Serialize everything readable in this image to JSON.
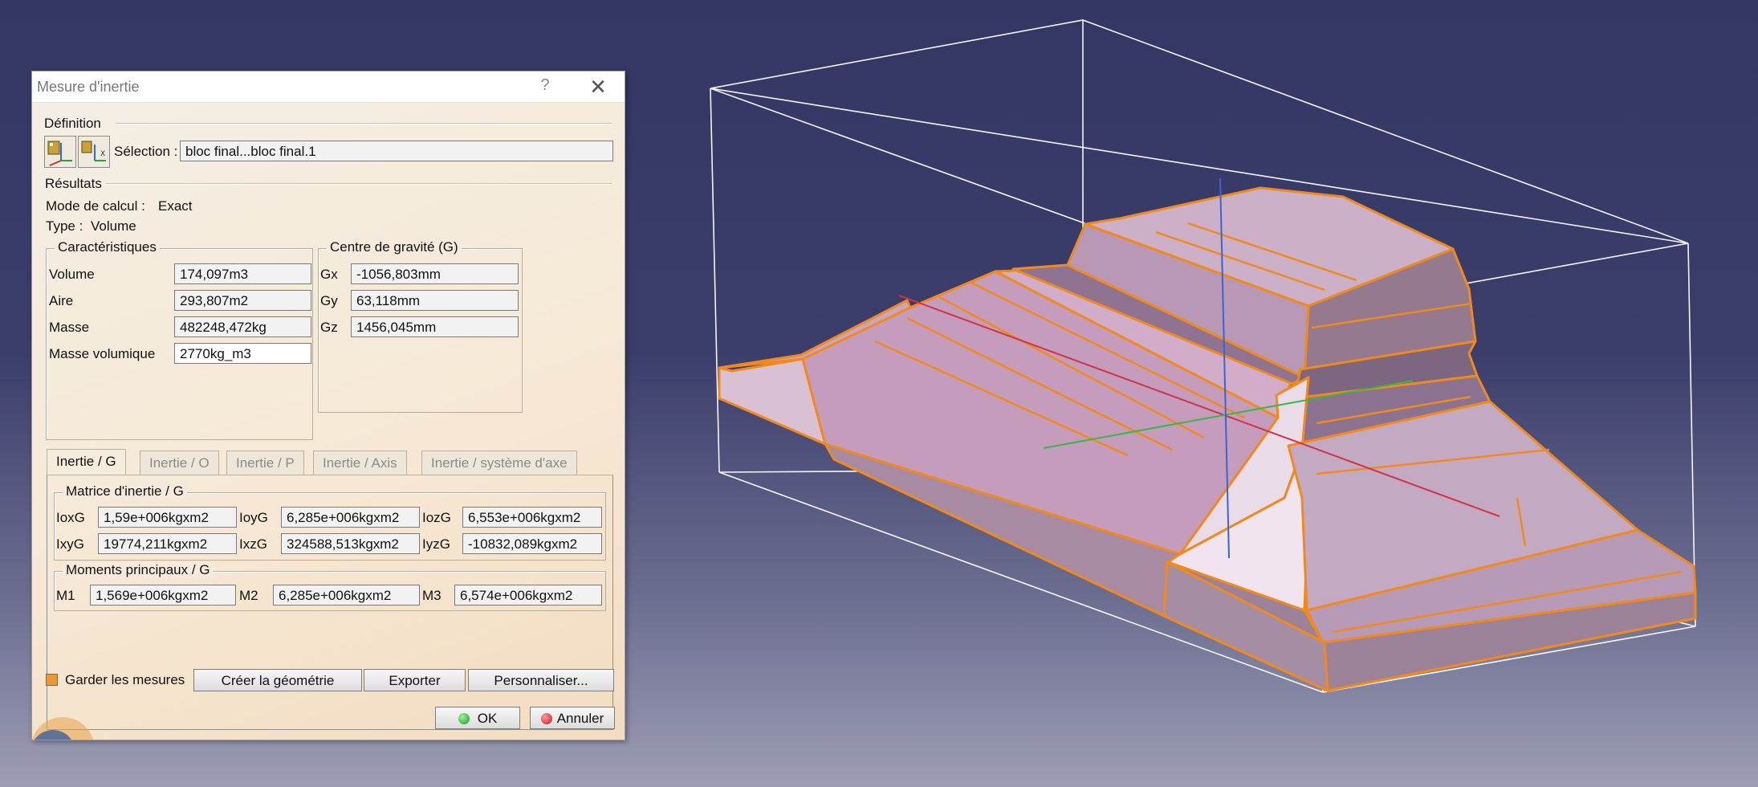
{
  "dialog": {
    "title": "Mesure d'inertie",
    "help": "?",
    "close": "✕",
    "definition_label": "Définition",
    "selection_label": "Sélection :",
    "selection_value": "bloc final...bloc final.1",
    "results_label": "Résultats",
    "mode_label": "Mode de calcul :",
    "mode_value": "Exact",
    "type_label": "Type :",
    "type_value": "Volume"
  },
  "characteristics": {
    "title": "Caractéristiques",
    "rows": [
      {
        "label": "Volume",
        "value": "174,097m3"
      },
      {
        "label": "Aire",
        "value": "293,807m2"
      },
      {
        "label": "Masse",
        "value": "482248,472kg"
      },
      {
        "label": "Masse volumique",
        "value": "2770kg_m3"
      }
    ]
  },
  "gravity": {
    "title": "Centre de gravité (G)",
    "rows": [
      {
        "label": "Gx",
        "value": "-1056,803mm"
      },
      {
        "label": "Gy",
        "value": "63,118mm"
      },
      {
        "label": "Gz",
        "value": "1456,045mm"
      }
    ]
  },
  "tabs": [
    "Inertie / G",
    "Inertie / O",
    "Inertie / P",
    "Inertie / Axis",
    "Inertie / système d'axe"
  ],
  "matrix": {
    "title": "Matrice d'inertie / G",
    "row1": [
      {
        "label": "IoxG",
        "value": "1,59e+006kgxm2"
      },
      {
        "label": "IoyG",
        "value": "6,285e+006kgxm2"
      },
      {
        "label": "IozG",
        "value": "6,553e+006kgxm2"
      }
    ],
    "row2": [
      {
        "label": "IxyG",
        "value": "19774,211kgxm2"
      },
      {
        "label": "IxzG",
        "value": "324588,513kgxm2"
      },
      {
        "label": "IyzG",
        "value": "-10832,089kgxm2"
      }
    ]
  },
  "moments": {
    "title": "Moments principaux / G",
    "row": [
      {
        "label": "M1",
        "value": "1,569e+006kgxm2"
      },
      {
        "label": "M2",
        "value": "6,285e+006kgxm2"
      },
      {
        "label": "M3",
        "value": "6,574e+006kgxm2"
      }
    ]
  },
  "footer": {
    "keep_label": "Garder les mesures",
    "create_label": "Créer la géométrie",
    "export_label": "Exporter",
    "customize_label": "Personnaliser...",
    "ok_label": "OK",
    "cancel_label": "Annuler"
  },
  "colors": {
    "edge_highlight": "#f08a1e",
    "face": "#d4b3c9",
    "axis_x": "#d1324a",
    "axis_y": "#39b54a",
    "axis_z": "#3b63d6"
  },
  "icons": [
    "measure-inertia-icon",
    "measure-inertia-2d-icon",
    "ok-green-dot-icon",
    "cancel-red-dot-icon"
  ]
}
